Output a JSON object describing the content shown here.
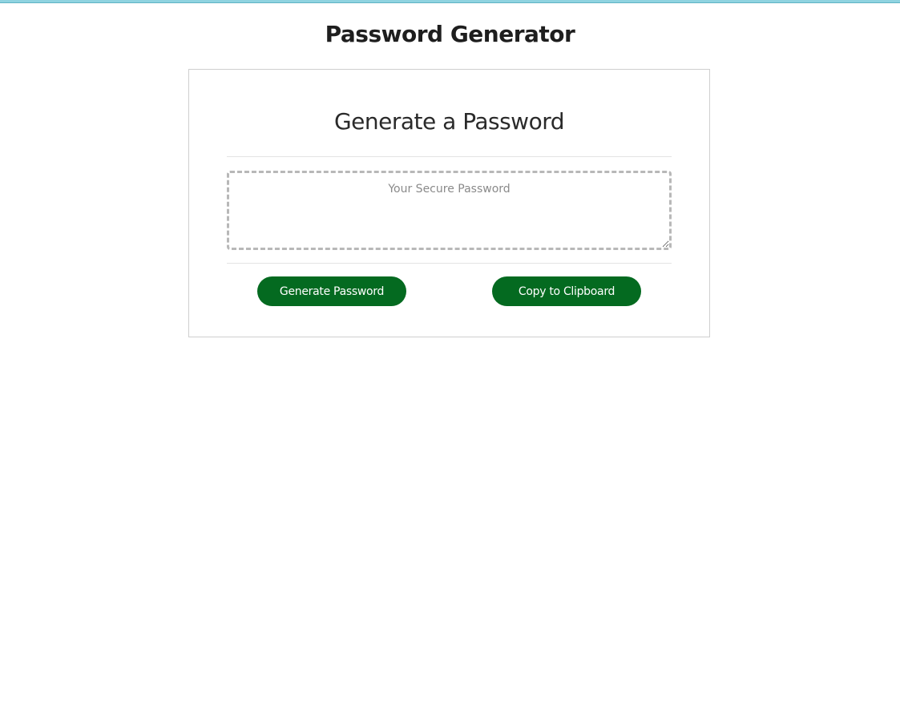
{
  "page": {
    "title": "Password Generator"
  },
  "card": {
    "header": "Generate a Password",
    "password_field": {
      "value": "",
      "placeholder": "Your Secure Password"
    },
    "buttons": {
      "generate_label": "Generate Password",
      "copy_label": "Copy to Clipboard"
    }
  },
  "colors": {
    "accent": "#046a20",
    "top_bar": "#8fd3e0"
  }
}
